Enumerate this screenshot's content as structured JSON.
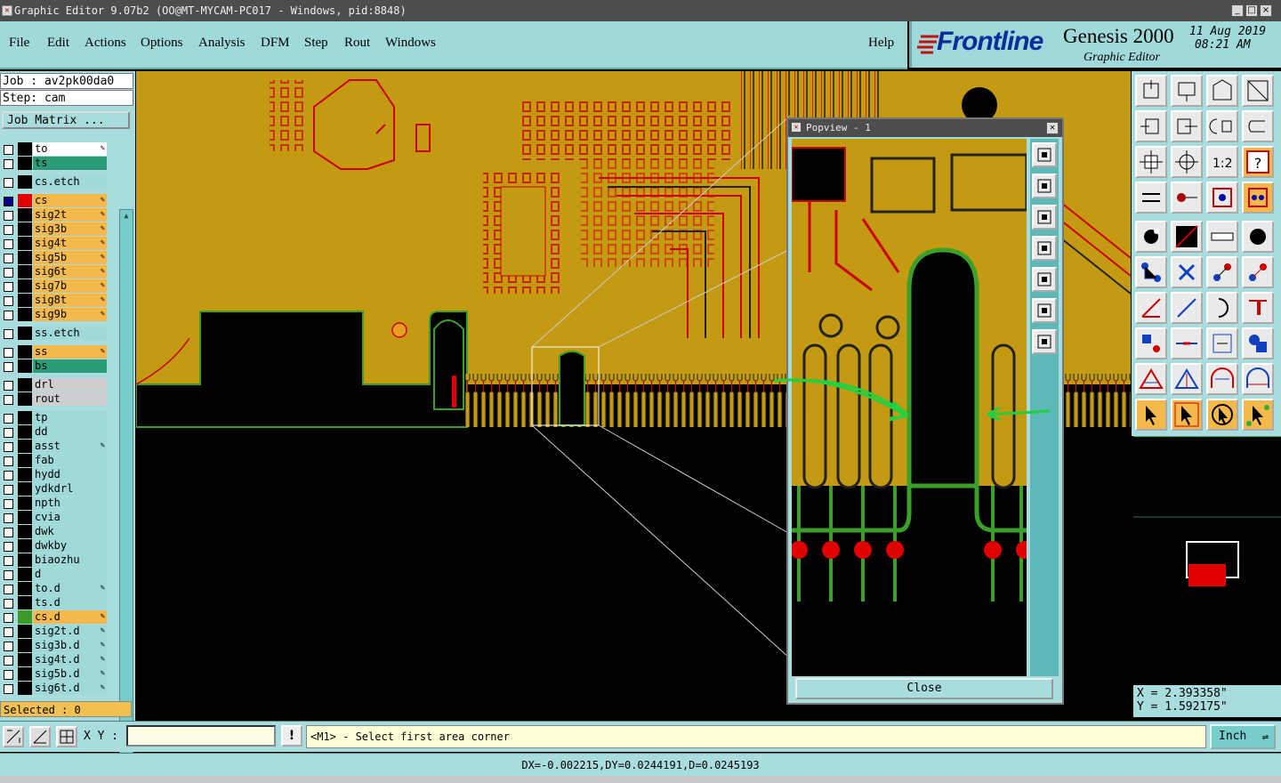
{
  "window": {
    "title": "Graphic Editor 9.07b2 (OO@MT-MYCAM-PC017 - Windows, pid:8848)",
    "controls": [
      "_",
      "□",
      "×"
    ]
  },
  "menu": {
    "items": [
      "File",
      "Edit",
      "Actions",
      "Options",
      "Analysis",
      "DFM",
      "Step",
      "Rout",
      "Windows"
    ],
    "help": "Help"
  },
  "brand": {
    "logo": "Frontline",
    "product": "Genesis 2000",
    "subtitle": "Graphic Editor",
    "date": "11 Aug 2019",
    "time": "08:21 AM"
  },
  "job": {
    "job_line": "Job : av2pk00da0",
    "step_line": "Step: cam",
    "matrix_button": "Job Matrix ..."
  },
  "layers": [
    {
      "name": "to",
      "color": "#ffffff",
      "swatch": "#000000",
      "edit": true
    },
    {
      "name": "ts",
      "color": "#2a9d78",
      "swatch": "#000000",
      "edit": false
    },
    {
      "name": "cs.etch",
      "color": "#9fd9d9",
      "swatch": "#000000",
      "edit": false
    },
    {
      "name": "cs",
      "color": "#f5b84a",
      "swatch": "#e00000",
      "edit": true,
      "active": true
    },
    {
      "name": "sig2t",
      "color": "#f5b84a",
      "swatch": "#000000",
      "edit": true
    },
    {
      "name": "sig3b",
      "color": "#f5b84a",
      "swatch": "#000000",
      "edit": true
    },
    {
      "name": "sig4t",
      "color": "#f5b84a",
      "swatch": "#000000",
      "edit": true
    },
    {
      "name": "sig5b",
      "color": "#f5b84a",
      "swatch": "#000000",
      "edit": true
    },
    {
      "name": "sig6t",
      "color": "#f5b84a",
      "swatch": "#000000",
      "edit": true
    },
    {
      "name": "sig7b",
      "color": "#f5b84a",
      "swatch": "#000000",
      "edit": true
    },
    {
      "name": "sig8t",
      "color": "#f5b84a",
      "swatch": "#000000",
      "edit": true
    },
    {
      "name": "sig9b",
      "color": "#f5b84a",
      "swatch": "#000000",
      "edit": true
    },
    {
      "name": "ss.etch",
      "color": "#9fd9d9",
      "swatch": "#000000",
      "edit": false
    },
    {
      "name": "ss",
      "color": "#f5b84a",
      "swatch": "#000000",
      "edit": true
    },
    {
      "name": "bs",
      "color": "#2a9d78",
      "swatch": "#000000",
      "edit": false
    },
    {
      "name": "drl",
      "color": "#cfcfcf",
      "swatch": "#000000",
      "edit": false
    },
    {
      "name": "rout",
      "color": "#cfcfcf",
      "swatch": "#000000",
      "edit": false
    },
    {
      "name": "tp",
      "color": "#9fd9d9",
      "swatch": "#000000",
      "edit": false
    },
    {
      "name": "dd",
      "color": "#9fd9d9",
      "swatch": "#000000",
      "edit": false
    },
    {
      "name": "asst",
      "color": "#9fd9d9",
      "swatch": "#000000",
      "edit": true
    },
    {
      "name": "fab",
      "color": "#9fd9d9",
      "swatch": "#000000",
      "edit": false
    },
    {
      "name": "hydd",
      "color": "#9fd9d9",
      "swatch": "#000000",
      "edit": false
    },
    {
      "name": "ydkdrl",
      "color": "#9fd9d9",
      "swatch": "#000000",
      "edit": false
    },
    {
      "name": "npth",
      "color": "#9fd9d9",
      "swatch": "#000000",
      "edit": false
    },
    {
      "name": "cvia",
      "color": "#9fd9d9",
      "swatch": "#000000",
      "edit": false
    },
    {
      "name": "dwk",
      "color": "#9fd9d9",
      "swatch": "#000000",
      "edit": false
    },
    {
      "name": "dwkby",
      "color": "#9fd9d9",
      "swatch": "#000000",
      "edit": false
    },
    {
      "name": "biaozhu",
      "color": "#9fd9d9",
      "swatch": "#000000",
      "edit": false
    },
    {
      "name": "d",
      "color": "#9fd9d9",
      "swatch": "#000000",
      "edit": false
    },
    {
      "name": "to.d",
      "color": "#9fd9d9",
      "swatch": "#000000",
      "edit": true
    },
    {
      "name": "ts.d",
      "color": "#9fd9d9",
      "swatch": "#000000",
      "edit": false
    },
    {
      "name": "cs.d",
      "color": "#f5b84a",
      "swatch": "#3a9a2a",
      "edit": true
    },
    {
      "name": "sig2t.d",
      "color": "#9fd9d9",
      "swatch": "#000000",
      "edit": true
    },
    {
      "name": "sig3b.d",
      "color": "#9fd9d9",
      "swatch": "#000000",
      "edit": true
    },
    {
      "name": "sig4t.d",
      "color": "#9fd9d9",
      "swatch": "#000000",
      "edit": true
    },
    {
      "name": "sig5b.d",
      "color": "#9fd9d9",
      "swatch": "#000000",
      "edit": true
    },
    {
      "name": "sig6t.d",
      "color": "#9fd9d9",
      "swatch": "#000000",
      "edit": true
    }
  ],
  "selected": "Selected : 0",
  "popview": {
    "title": "Popview - 1",
    "close_button": "Close"
  },
  "coordinates": {
    "x": "X = 2.393358\"",
    "y": "Y = 1.592175\""
  },
  "bottom": {
    "xy_label": "X Y :",
    "xy_value": "",
    "warn_icon": "!",
    "prompt": "<M1> - Select first area corner",
    "unit": "Inch"
  },
  "status": "DX=-0.002215,DY=0.0244191,D=0.0245193",
  "colors": {
    "board": "#c39a12",
    "panel": "#a9dcdc",
    "trace_red": "#e00000",
    "trace_green": "#3aa02a"
  }
}
